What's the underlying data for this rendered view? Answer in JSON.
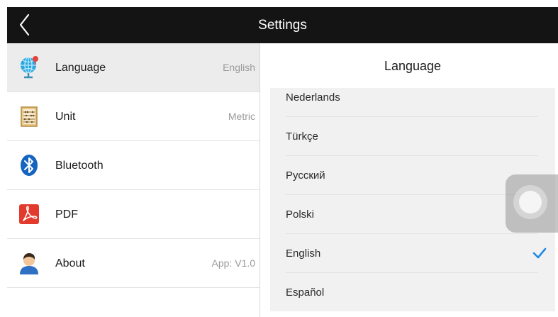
{
  "topbar": {
    "title": "Settings",
    "back_icon": "chevron-left-icon"
  },
  "menu": {
    "items": [
      {
        "label": "Language",
        "value": "English",
        "icon": "globe-icon",
        "selected": true
      },
      {
        "label": "Unit",
        "value": "Metric",
        "icon": "abacus-icon",
        "selected": false
      },
      {
        "label": "Bluetooth",
        "value": "",
        "icon": "bluetooth-icon",
        "selected": false
      },
      {
        "label": "PDF",
        "value": "",
        "icon": "pdf-icon",
        "selected": false
      },
      {
        "label": "About",
        "value": "App: V1.0",
        "icon": "user-icon",
        "selected": false
      }
    ]
  },
  "language_panel": {
    "title": "Language",
    "options": [
      {
        "label": "Nederlands",
        "selected": false
      },
      {
        "label": "Türkçe",
        "selected": false
      },
      {
        "label": "Русский",
        "selected": false
      },
      {
        "label": "Polski",
        "selected": false
      },
      {
        "label": "English",
        "selected": true
      },
      {
        "label": "Español",
        "selected": false
      }
    ]
  },
  "colors": {
    "topbar": "#141414",
    "selected_row": "#ececec",
    "list_bg": "#f1f1f1",
    "check": "#1e88e5"
  }
}
